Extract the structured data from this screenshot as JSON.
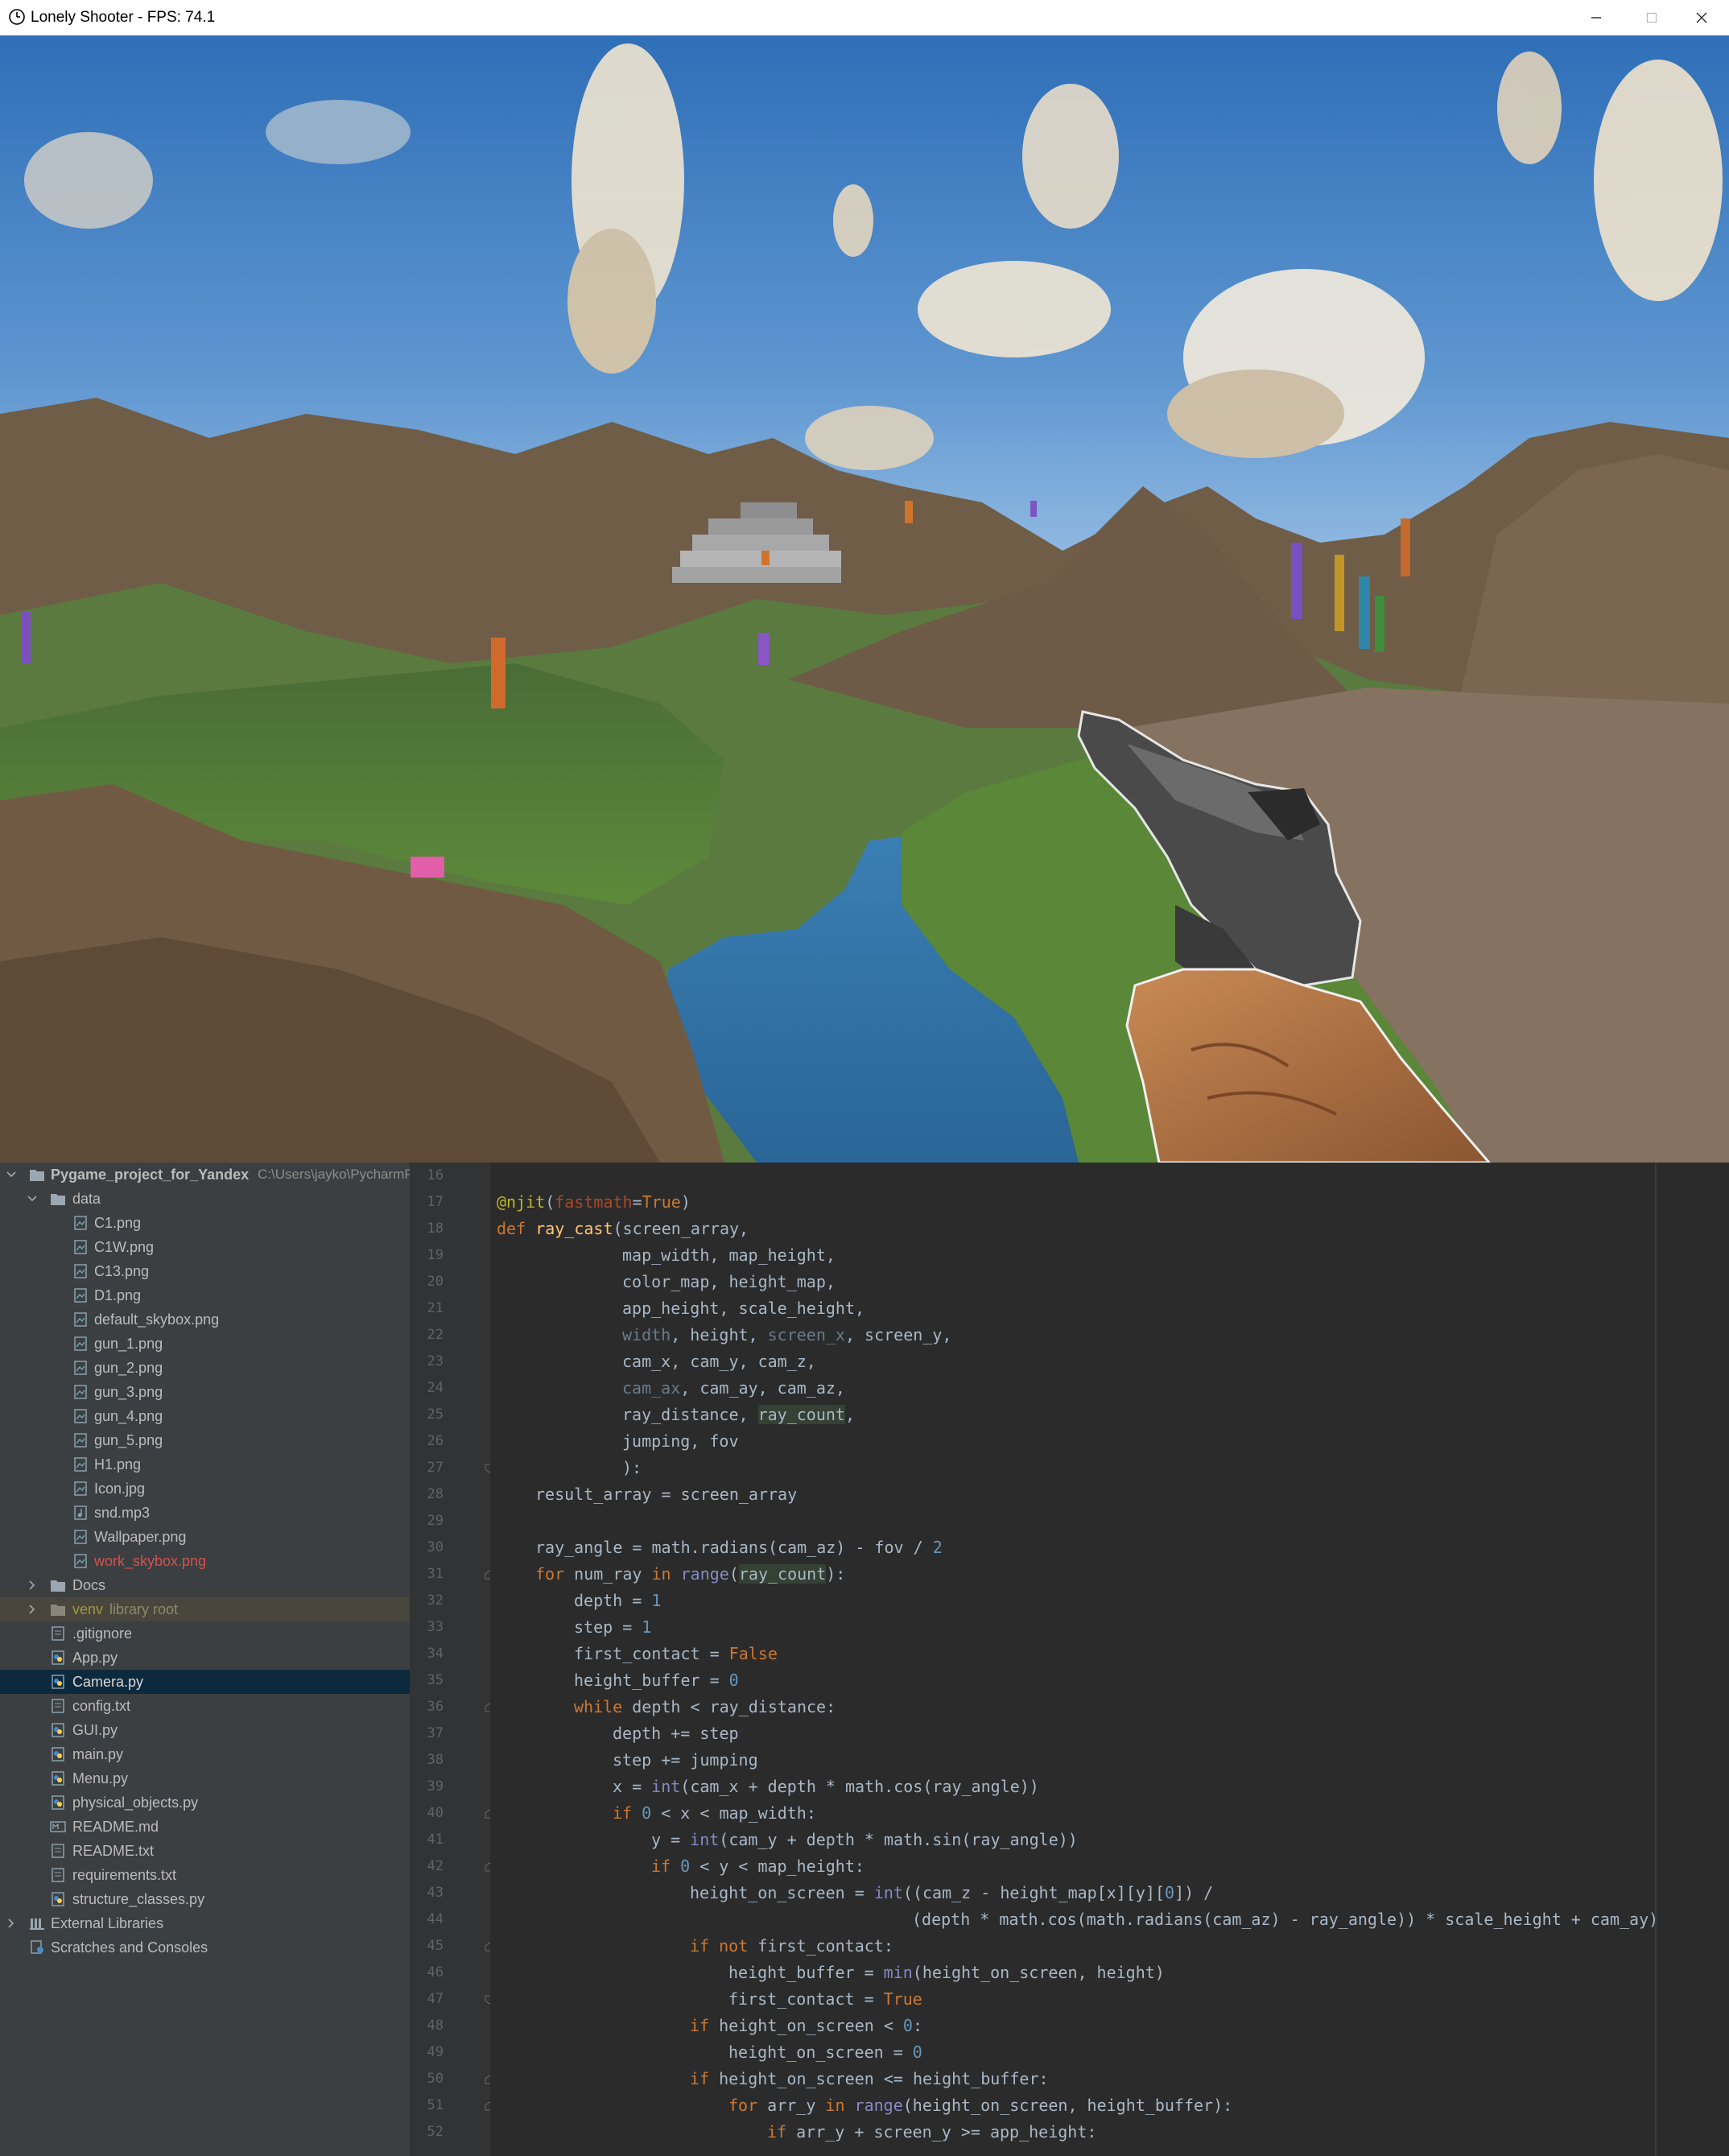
{
  "window": {
    "title": "Lonely Shooter - FPS: 74.1",
    "icon": "pygame-clock-icon",
    "controls": [
      "minimize-icon",
      "maximize-icon",
      "close-icon"
    ]
  },
  "viewport": {
    "scene": "voxel-terrain-render",
    "sky_color": "#4d86c9",
    "water_color": "#3a7fb3",
    "grass_color": "#4f7a33",
    "rock_color": "#7b6852"
  },
  "project": {
    "root_name": "Pygame_project_for_Yandex",
    "root_path": "C:\\Users\\jayko\\PycharmP",
    "data_folder": "data",
    "data_files": [
      {
        "name": "C1.png"
      },
      {
        "name": "C1W.png"
      },
      {
        "name": "C13.png"
      },
      {
        "name": "D1.png"
      },
      {
        "name": "default_skybox.png"
      },
      {
        "name": "gun_1.png"
      },
      {
        "name": "gun_2.png"
      },
      {
        "name": "gun_3.png"
      },
      {
        "name": "gun_4.png"
      },
      {
        "name": "gun_5.png"
      },
      {
        "name": "H1.png"
      },
      {
        "name": "Icon.jpg"
      },
      {
        "name": "snd.mp3"
      },
      {
        "name": "Wallpaper.png"
      },
      {
        "name": "work_skybox.png"
      }
    ],
    "docs_folder": "Docs",
    "venv_folder": "venv",
    "venv_hint": "library root",
    "root_files": [
      {
        "name": ".gitignore"
      },
      {
        "name": "App.py"
      },
      {
        "name": "Camera.py"
      },
      {
        "name": "config.txt"
      },
      {
        "name": "GUI.py"
      },
      {
        "name": "main.py"
      },
      {
        "name": "Menu.py"
      },
      {
        "name": "physical_objects.py"
      },
      {
        "name": "README.md"
      },
      {
        "name": "README.txt"
      },
      {
        "name": "requirements.txt"
      },
      {
        "name": "structure_classes.py"
      }
    ],
    "external_libraries": "External Libraries",
    "scratches": "Scratches and Consoles"
  },
  "editor": {
    "line_numbers": [
      "16",
      "17",
      "18",
      "19",
      "20",
      "21",
      "22",
      "23",
      "24",
      "25",
      "26",
      "27",
      "28",
      "29",
      "30",
      "31",
      "32",
      "33",
      "34",
      "35",
      "36",
      "37",
      "38",
      "39",
      "40",
      "41",
      "42",
      "43",
      "44",
      "45",
      "46",
      "47",
      "48",
      "49",
      "50",
      "51",
      "52"
    ],
    "code": {
      "l17_dec": "@njit",
      "l17_param": "fastmath",
      "l17_val": "True",
      "l18_def": "def ",
      "l18_name": "ray_cast",
      "l18_rest": "(screen_array,",
      "l19": "map_width, map_height,",
      "l20": "color_map, height_map,",
      "l21": "app_height, scale_height,",
      "l22_a": "width",
      "l22_b": ", height, ",
      "l22_c": "screen_x",
      "l22_d": ", screen_y,",
      "l23": "cam_x, cam_y, cam_z,",
      "l24_a": "cam_ax",
      "l24_b": ", cam_ay, cam_az,",
      "l25_a": "ray_distance, ",
      "l25_b": "ray_count",
      "l25_c": ",",
      "l26": "jumping, fov",
      "l27": "):",
      "l28": "result_array = screen_array",
      "l30_a": "ray_angle = math.radians(cam_az) - fov / ",
      "l30_n": "2",
      "l31_for": "for ",
      "l31_a": "num_ray ",
      "l31_in": "in ",
      "l31_range": "range",
      "l31_b": "(",
      "l31_c": "ray_count",
      "l31_d": "):",
      "l32_a": "depth = ",
      "l32_n": "1",
      "l33_a": "step = ",
      "l33_n": "1",
      "l34_a": "first_contact = ",
      "l34_v": "False",
      "l35_a": "height_buffer = ",
      "l35_n": "0",
      "l36_kw": "while ",
      "l36_a": "depth < ray_distance:",
      "l37": "depth += step",
      "l38": "step += jumping",
      "l39_a": "x = ",
      "l39_int": "int",
      "l39_b": "(cam_x + depth * math.cos(ray_angle))",
      "l40_kw": "if ",
      "l40_n": "0",
      "l40_a": " < x < map_width:",
      "l41_a": "y = ",
      "l41_int": "int",
      "l41_b": "(cam_y + depth * math.sin(ray_angle))",
      "l42_kw": "if ",
      "l42_n": "0",
      "l42_a": " < y < map_height:",
      "l43_a": "height_on_screen = ",
      "l43_int": "int",
      "l43_b": "((cam_z - height_map[x][y][",
      "l43_n": "0",
      "l43_c": "]) /",
      "l44": "(depth * math.cos(math.radians(cam_az) - ray_angle)) * scale_height + cam_ay)",
      "l45_kw": "if not ",
      "l45_a": "first_contact:",
      "l46_a": "height_buffer = ",
      "l46_min": "min",
      "l46_b": "(height_on_screen, height)",
      "l47_a": "first_contact = ",
      "l47_v": "True",
      "l48_kw": "if ",
      "l48_a": "height_on_screen < ",
      "l48_n": "0",
      "l48_b": ":",
      "l49_a": "height_on_screen = ",
      "l49_n": "0",
      "l50_kw": "if ",
      "l50_a": "height_on_screen <= height_buffer:",
      "l51_for": "for ",
      "l51_a": "arr_y ",
      "l51_in": "in ",
      "l51_range": "range",
      "l51_b": "(height_on_screen, height_buffer):",
      "l52_kw": "if ",
      "l52_a": "arr_y + screen_y >= app_height:"
    }
  }
}
